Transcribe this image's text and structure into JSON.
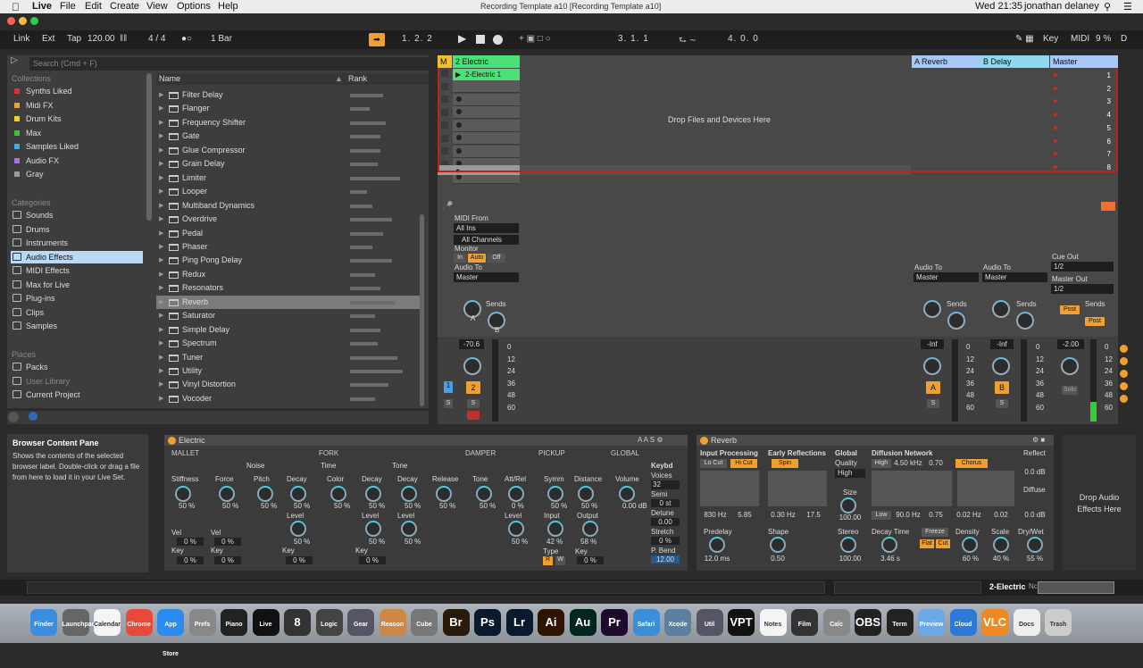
{
  "menubar": {
    "app": "Live",
    "items": [
      "File",
      "Edit",
      "Create",
      "View",
      "Options",
      "Help"
    ],
    "window_title": "Recording Template a10  [Recording Template a10]",
    "clock": "Wed 21:35",
    "user": "jonathan delaney"
  },
  "toolbar": {
    "link": "Link",
    "ext": "Ext",
    "tap": "Tap",
    "tempo": "120.00",
    "time_sig": "4 / 4",
    "quantize": "1 Bar",
    "arrangement_position": "1.   2.   2",
    "loop_start": "3.   1.   1",
    "loop_length": "4.   0.   0",
    "key": "Key",
    "midi": "MIDI",
    "cpu": "9 %",
    "disk": "D"
  },
  "browser": {
    "search_placeholder": "Search (Cmd + F)",
    "collections_header": "Collections",
    "collections": [
      {
        "label": "Synths Liked",
        "color": "#e03030"
      },
      {
        "label": "Midi FX",
        "color": "#f0a030"
      },
      {
        "label": "Drum Kits",
        "color": "#f0d020"
      },
      {
        "label": "Max",
        "color": "#40c040"
      },
      {
        "label": "Samples Liked",
        "color": "#40b0e0"
      },
      {
        "label": "Audio FX",
        "color": "#b070e0"
      },
      {
        "label": "Gray",
        "color": "#999999"
      }
    ],
    "categories_header": "Categories",
    "categories": [
      "Sounds",
      "Drums",
      "Instruments",
      "Audio Effects",
      "MIDI Effects",
      "Max for Live",
      "Plug-ins",
      "Clips",
      "Samples"
    ],
    "places_header": "Places",
    "places": [
      "Packs",
      "User Library",
      "Current Project"
    ],
    "col_name": "Name",
    "col_rank": "Rank",
    "items": [
      {
        "name": "Filter Delay",
        "rank": 0.6
      },
      {
        "name": "Flanger",
        "rank": 0.35
      },
      {
        "name": "Frequency Shifter",
        "rank": 0.65
      },
      {
        "name": "Gate",
        "rank": 0.55
      },
      {
        "name": "Glue Compressor",
        "rank": 0.55
      },
      {
        "name": "Grain Delay",
        "rank": 0.5
      },
      {
        "name": "Limiter",
        "rank": 0.9
      },
      {
        "name": "Looper",
        "rank": 0.3
      },
      {
        "name": "Multiband Dynamics",
        "rank": 0.4
      },
      {
        "name": "Overdrive",
        "rank": 0.75
      },
      {
        "name": "Pedal",
        "rank": 0.6
      },
      {
        "name": "Phaser",
        "rank": 0.4
      },
      {
        "name": "Ping Pong Delay",
        "rank": 0.75
      },
      {
        "name": "Redux",
        "rank": 0.45
      },
      {
        "name": "Resonators",
        "rank": 0.55
      },
      {
        "name": "Reverb",
        "rank": 0.8
      },
      {
        "name": "Saturator",
        "rank": 0.45
      },
      {
        "name": "Simple Delay",
        "rank": 0.55
      },
      {
        "name": "Spectrum",
        "rank": 0.5
      },
      {
        "name": "Tuner",
        "rank": 0.85
      },
      {
        "name": "Utility",
        "rank": 0.95
      },
      {
        "name": "Vinyl Distortion",
        "rank": 0.7
      },
      {
        "name": "Vocoder",
        "rank": 0.45
      }
    ]
  },
  "session": {
    "track1": "2 Electric",
    "clip1": "2-Electric 1",
    "drop_hint": "Drop Files and Devices Here",
    "return_a": "A Reverb",
    "return_b": "B Delay",
    "master": "Master",
    "scenes": [
      "1",
      "2",
      "3",
      "4",
      "5",
      "6",
      "7",
      "8"
    ],
    "midi_from": "MIDI From",
    "all_ins": "All Ins",
    "all_channels": "All Channels",
    "monitor": "Monitor",
    "mon_in": "In",
    "mon_auto": "Auto",
    "mon_off": "Off",
    "audio_to": "Audio To",
    "audio_to_value": "Master",
    "sends": "Sends",
    "knob_a": "A",
    "knob_b": "B",
    "track_vol": "-70.6",
    "return_a_vol": "-Inf",
    "return_b_vol": "-Inf",
    "master_vol": "-2.00",
    "db_scale": [
      "0",
      "12",
      "24",
      "36",
      "48",
      "60"
    ],
    "track_num": "2",
    "solo": "S",
    "cue_out": "Cue Out",
    "cue_out_value": "1/2",
    "master_out": "Master Out",
    "master_out_value": "1/2",
    "post": "Post",
    "solo_label": "Solo"
  },
  "info": {
    "title": "Browser Content Pane",
    "text": "Shows the contents of the selected browser label. Double-click or drag a file from here to load it in your Live Set."
  },
  "electric": {
    "title": "Electric",
    "sections": [
      "MALLET",
      "FORK",
      "DAMPER",
      "PICKUP",
      "GLOBAL"
    ],
    "sub_noise": "Noise",
    "sub_time": "Time",
    "sub_tone": "Tone",
    "params": [
      {
        "label": "Stiffness",
        "value": "50 %"
      },
      {
        "label": "Force",
        "value": "50 %"
      },
      {
        "label": "Pitch",
        "value": "50 %"
      },
      {
        "label": "Decay",
        "value": "50 %"
      },
      {
        "label": "Color",
        "value": "50 %"
      },
      {
        "label": "Decay",
        "value": "50 %"
      },
      {
        "label": "Decay",
        "value": "50 %"
      },
      {
        "label": "Release",
        "value": "50 %"
      },
      {
        "label": "Tone",
        "value": "50 %"
      },
      {
        "label": "Att/Rel",
        "value": "0 %"
      },
      {
        "label": "Symm",
        "value": "50 %"
      },
      {
        "label": "Distance",
        "value": "50 %"
      },
      {
        "label": "Volume",
        "value": "0.00 dB"
      }
    ],
    "level_noise": "50 %",
    "level_time": "50 %",
    "level_tone": "50 %",
    "level_damper": "50 %",
    "level_label": "Level",
    "vel_label": "Vel",
    "key_label": "Key",
    "vel1": "0 %",
    "key1": "0 %",
    "vel2": "0 %",
    "key2": "0 %",
    "key3": "0 %",
    "key4": "0 %",
    "key5": "0 %",
    "input_label": "Input",
    "input_value": "42 %",
    "output_label": "Output",
    "output_value": "58 %",
    "type_label": "Type",
    "type_r": "R",
    "type_w": "W",
    "keybd": "Keybd",
    "voices": "Voices",
    "voices_value": "32",
    "semi": "Semi",
    "semi_value": "0 st",
    "detune": "Detune",
    "detune_value": "0.00",
    "stretch": "Stretch",
    "stretch_value": "0 %",
    "pbend": "P. Bend",
    "pbend_value": "12.00"
  },
  "reverb": {
    "title": "Reverb",
    "input_processing": "Input Processing",
    "lo_cut": "Lo Cut",
    "hi_cut": "Hi Cut",
    "lo_freq": "830 Hz",
    "lo_q": "5.85",
    "early_reflections": "Early Reflections",
    "spin": "Spin",
    "er_freq": "0.30 Hz",
    "er_amt": "17.5",
    "global": "Global",
    "quality": "Quality",
    "quality_value": "High",
    "size": "Size",
    "size_value": "100.00",
    "diffusion_network": "Diffusion Network",
    "high": "High",
    "high_freq": "4.50 kHz",
    "high_amt": "0.70",
    "low": "Low",
    "low_freq": "90.0 Hz",
    "low_amt": "0.75",
    "chorus": "Chorus",
    "chorus_a": "0.02 Hz",
    "chorus_b": "0.02",
    "reflect": "Reflect",
    "reflect_value": "0.0 dB",
    "diffuse": "Diffuse",
    "diffuse_value": "0.0 dB",
    "predelay": "Predelay",
    "predelay_value": "12.0 ms",
    "shape": "Shape",
    "shape_value": "0.50",
    "stereo": "Stereo",
    "stereo_value": "100.00",
    "decay_time": "Decay Time",
    "decay_value": "3.46 s",
    "freeze": "Freeze",
    "flat": "Flat",
    "cut": "Cut",
    "density": "Density",
    "density_value": "60 %",
    "scale": "Scale",
    "scale_value": "40 %",
    "drywet": "Dry/Wet",
    "drywet_value": "55 %"
  },
  "drop_audio": "Drop Audio Effects Here",
  "status": {
    "track": "2-Electric",
    "nc": "Nc"
  },
  "dock": [
    {
      "label": "Finder",
      "color": "#3b8de0"
    },
    {
      "label": "Launchpad",
      "color": "#666"
    },
    {
      "label": "Calendar",
      "color": "#f5f5f5"
    },
    {
      "label": "Chrome",
      "color": "#e84a3a"
    },
    {
      "label": "App Store",
      "color": "#2a8cf0"
    },
    {
      "label": "Prefs",
      "color": "#888"
    },
    {
      "label": "Piano",
      "color": "#222"
    },
    {
      "label": "Live",
      "color": "#111"
    },
    {
      "label": "8",
      "color": "#333"
    },
    {
      "label": "Logic",
      "color": "#444"
    },
    {
      "label": "Gear",
      "color": "#556"
    },
    {
      "label": "Reason",
      "color": "#c84"
    },
    {
      "label": "Cube",
      "color": "#777"
    },
    {
      "label": "Br",
      "color": "#2a1a0a"
    },
    {
      "label": "Ps",
      "color": "#0a1a2e"
    },
    {
      "label": "Lr",
      "color": "#0a1a2e"
    },
    {
      "label": "Ai",
      "color": "#2e1400"
    },
    {
      "label": "Au",
      "color": "#00261e"
    },
    {
      "label": "Pr",
      "color": "#1e0a2e"
    },
    {
      "label": "Safari",
      "color": "#3a8fd8"
    },
    {
      "label": "Xcode",
      "color": "#5a7fa0"
    },
    {
      "label": "Util",
      "color": "#556"
    },
    {
      "label": "VPT",
      "color": "#111"
    },
    {
      "label": "Notes",
      "color": "#f4f4f4"
    },
    {
      "label": "Film",
      "color": "#333"
    },
    {
      "label": "Calc",
      "color": "#888"
    },
    {
      "label": "OBS",
      "color": "#222"
    },
    {
      "label": "Term",
      "color": "#222"
    },
    {
      "label": "Preview",
      "color": "#6aa8e8"
    },
    {
      "label": "Cloud",
      "color": "#2c7ad8"
    },
    {
      "label": "VLC",
      "color": "#f08a20"
    },
    {
      "label": "Docs",
      "color": "#eee"
    },
    {
      "label": "Trash",
      "color": "#ccc"
    }
  ]
}
